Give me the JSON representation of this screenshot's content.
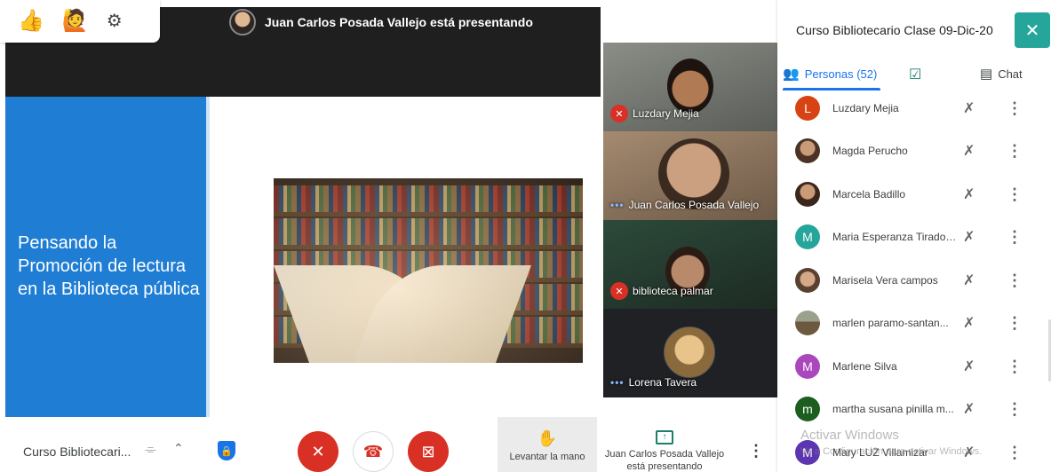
{
  "presentation": {
    "banner": "Juan Carlos Posada Vallejo está presentando",
    "slide_title": "Pensando la Promoción  de lectura en la Biblioteca pública"
  },
  "reactions": [
    {
      "icon": "thumbs-up-icon",
      "glyph": "👍"
    },
    {
      "icon": "raise-hand-person-icon",
      "glyph": "🙋"
    },
    {
      "icon": "gear-icon",
      "glyph": "⚙"
    }
  ],
  "tiles": [
    {
      "name": "Luzdary Mejia",
      "status": "muted"
    },
    {
      "name": "Juan Carlos Posada Vallejo",
      "status": "speaking"
    },
    {
      "name": "biblioteca palmar",
      "status": "muted"
    },
    {
      "name": "Lorena Tavera",
      "status": "speaking"
    }
  ],
  "panel": {
    "title": "Curso Bibliotecario Clase 09-Dic-20",
    "tabs": {
      "people": "Personas (52)",
      "chat": "Chat"
    },
    "people": [
      {
        "name": "Luzdary Mejia",
        "initial": "L",
        "color": "#d84315"
      },
      {
        "name": "Magda Perucho",
        "initial": "",
        "color": "#8d6e63"
      },
      {
        "name": "Marcela Badillo",
        "initial": "",
        "color": "#6d4c41"
      },
      {
        "name": "Maria Esperanza Tirado ...",
        "initial": "M",
        "color": "#26a69a"
      },
      {
        "name": "Marisela Vera campos",
        "initial": "",
        "color": "#795548"
      },
      {
        "name": "marlen paramo-santan...",
        "initial": "",
        "color": "#7c6a4f"
      },
      {
        "name": "Marlene Silva",
        "initial": "M",
        "color": "#ab47bc"
      },
      {
        "name": "martha susana pinilla m...",
        "initial": "m",
        "color": "#1b5e20"
      },
      {
        "name": "Mary LUZ Villamizar",
        "initial": "M",
        "color": "#5e35b1"
      }
    ]
  },
  "watermark": {
    "line1": "Activar Windows",
    "line2": "Ve a Configuración para activar Windows."
  },
  "bottombar": {
    "meeting_name": "Curso Bibliotecari...",
    "raise_hand_label": "Levantar la mano",
    "present_label_1": "Juan Carlos Posada Vallejo",
    "present_label_2": "está presentando"
  },
  "colors": {
    "mic_off_red": "#d93025",
    "slide_blue": "#1f7ed4",
    "close_teal": "#26a69a",
    "tab_active": "#1a73e8"
  }
}
